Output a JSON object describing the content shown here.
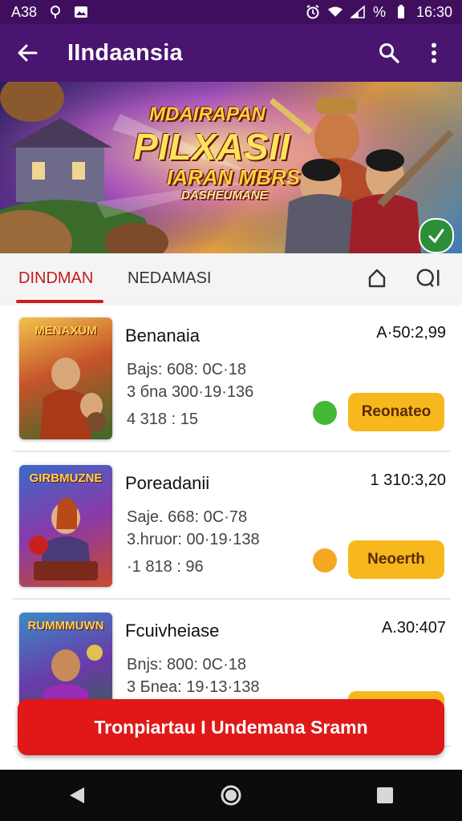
{
  "status_bar": {
    "left_text": "A38",
    "battery_text": "%",
    "time": "16:30",
    "icons": [
      "location-icon",
      "image-icon",
      "alarm-icon",
      "wifi-icon",
      "signal-icon",
      "battery-icon"
    ]
  },
  "app_bar": {
    "title": "IIndaansia",
    "icons": [
      "back-arrow-icon",
      "search-icon",
      "more-vert-icon"
    ]
  },
  "banner": {
    "line1": "MDAIRAPAN",
    "line2": "PILXASII",
    "line3": "IARAN MBRS",
    "line4": "DASHEUMANE"
  },
  "tabs": {
    "items": [
      {
        "label": "DINDMAN",
        "active": true
      },
      {
        "label": "NEDAMASI",
        "active": false
      }
    ],
    "icons": [
      "home-icon",
      "chat-icon"
    ]
  },
  "games": [
    {
      "thumb_title": "MENAXUM",
      "name": "Benanaia",
      "price": "A·50:2,99",
      "meta1": "Bajs: 608: 0C·18",
      "meta2": "3 бna  300·19·136",
      "meta3": "4 318 : 15",
      "dot_color": "#46b838",
      "button": "Reonateo"
    },
    {
      "thumb_title": "GIRBMUZNE",
      "name": "Poreadanii",
      "price": "1 310:3,20",
      "meta1": "Saje. 668: 0C·78",
      "meta2": "3.hruor: 00·19·138",
      "meta3": "·1 818 : 96",
      "dot_color": "#f5a623",
      "button": "Neoerth"
    },
    {
      "thumb_title": "RUMMMUWN",
      "name": "Fcuivheiase",
      "price": "A.30:407",
      "meta1": "Bnjs: 800: 0C·18",
      "meta2": "3 Бnea: 19·13·138",
      "meta3": "",
      "dot_color": "",
      "button": ""
    }
  ],
  "cta": {
    "label": "Tronpiartau I Undemana Sramn"
  },
  "nav_bar": {
    "icons": [
      "back-triangle-icon",
      "home-circle-icon",
      "recents-square-icon"
    ]
  },
  "colors": {
    "status_bar": "#3f0f5e",
    "app_bar": "#4a1570",
    "accent_red": "#e01818",
    "tab_active": "#c41a1a",
    "button_yellow": "#f7b81d"
  }
}
